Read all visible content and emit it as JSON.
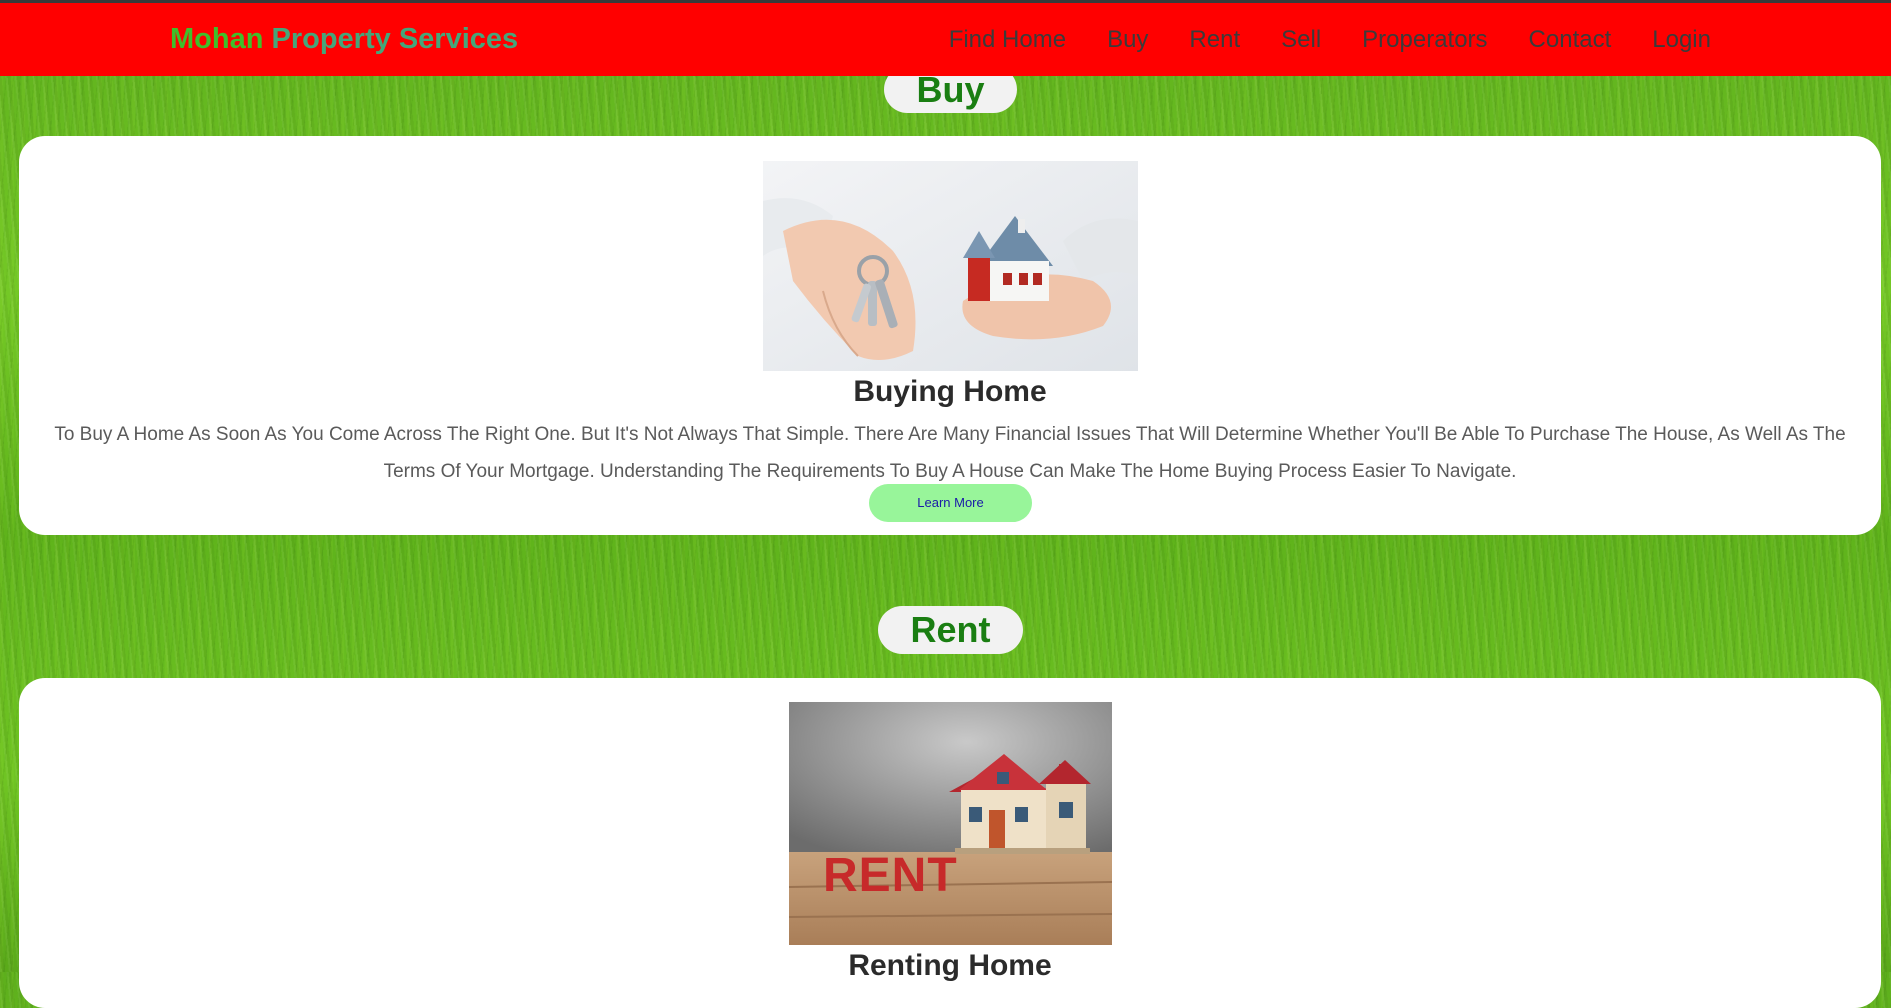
{
  "brand": {
    "first": "Mohan",
    "rest": "Property Services"
  },
  "nav": [
    "Find Home",
    "Buy",
    "Rent",
    "Sell",
    "Properators",
    "Contact",
    "Login"
  ],
  "sections": {
    "buy": {
      "title": "Buy",
      "heading": "Buying Home",
      "text": "To Buy A Home As Soon As You Come Across The Right One. But It's Not Always That Simple. There Are Many Financial Issues That Will Determine Whether You'll Be Able To Purchase The House, As Well As The Terms Of Your Mortgage. Understanding The Requirements To Buy A House Can Make The Home Buying Process Easier To Navigate.",
      "button": "Learn More"
    },
    "rent": {
      "title": "Rent",
      "heading": "Renting Home",
      "image_text": "RENT"
    }
  },
  "colors": {
    "navbar": "#ff0000",
    "brand_first": "#3fbf2a",
    "brand_rest": "#45a67a",
    "section_title": "#1a7e12",
    "button_bg": "#98f59a",
    "button_text": "#1a1aa8"
  }
}
